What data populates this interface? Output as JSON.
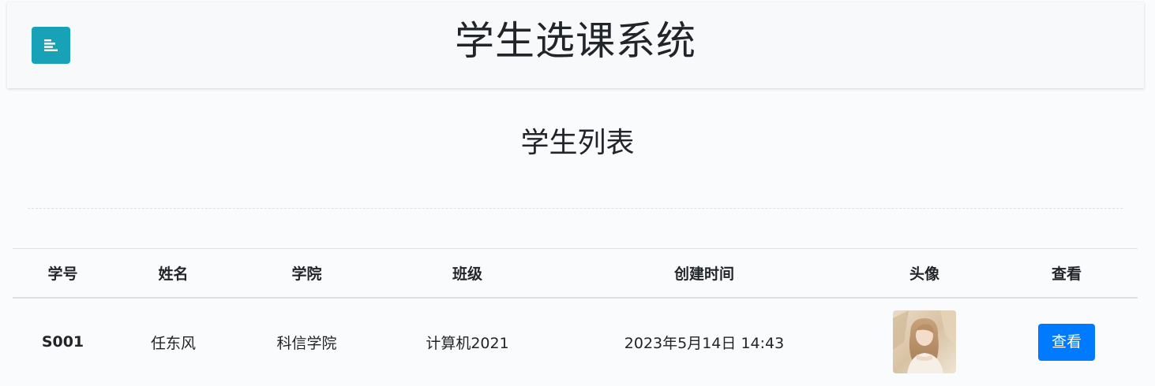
{
  "header": {
    "title": "学生选课系统",
    "menu_icon": "menu-align-left-icon",
    "menu_color": "#17a2b8"
  },
  "page": {
    "heading": "学生列表"
  },
  "table": {
    "columns": [
      "学号",
      "姓名",
      "学院",
      "班级",
      "创建时间",
      "头像",
      "查看"
    ],
    "rows": [
      {
        "id": "S001",
        "name": "任东风",
        "college": "科信学院",
        "class": "计算机2021",
        "created": "2023年5月14日 14:43",
        "avatar_icon": "student-avatar-photo",
        "action": "查看"
      }
    ]
  },
  "colors": {
    "primary_button": "#007bff",
    "accent": "#17a2b8"
  }
}
